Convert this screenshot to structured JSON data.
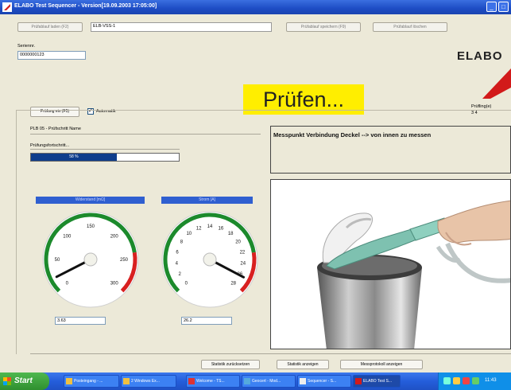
{
  "window": {
    "title": "ELABO Test Sequencer - Version[19.09.2003 17:05:00]"
  },
  "toolbar": {
    "btn1_label": "Prüfablauf laden (F2)",
    "combo_value": "ELB-VSS-1",
    "btn2_label": "Prüfablauf speichern (F9)",
    "btn3_label": "Prüfablauf löschen"
  },
  "serial": {
    "label": "Seriennr.",
    "value": "0000000123"
  },
  "logo": {
    "text": "ELABO"
  },
  "controls": {
    "start_label": "Prüfung ein (F5)",
    "auto_checkbox_label": "Automatik",
    "auto_checked": true
  },
  "status": {
    "text": "Prüfen..."
  },
  "counter": {
    "label": "Prüfling(e)",
    "value": "3 4"
  },
  "group": {
    "title": "PLB 05 - Prüfschritt Name"
  },
  "progress": {
    "label": "Prüfungsfortschritt...",
    "text": "58 %",
    "percent": 58
  },
  "gauges": [
    {
      "title": "Widerstand [mΩ]",
      "value": "3.63",
      "ticks": [
        "0",
        "50",
        "100",
        "150",
        "200",
        "250",
        "300"
      ],
      "needle": 20,
      "min": 0,
      "max": 300
    },
    {
      "title": "Strom [A]",
      "value": "26.2",
      "ticks": [
        "0",
        "2",
        "4",
        "6",
        "8",
        "10",
        "12",
        "14",
        "16",
        "18",
        "20",
        "22",
        "24",
        "26",
        "28"
      ],
      "needle": 26.2,
      "min": 0,
      "max": 28
    }
  ],
  "message": {
    "text": "Messpunkt Verbindung Deckel --> von innen zu messen"
  },
  "bottom_buttons": [
    "Statistik zurücksetzen",
    "Statistik anzeigen",
    "Messprotokoll anzeigen"
  ],
  "taskbar": {
    "start_label": "Start",
    "tasks": [
      "Posteingang - ...",
      "2 Windows Ex...",
      "Welcome - TS...",
      "Geocert - Mod...",
      "Sequencer - S...",
      "ELABO Test S..."
    ],
    "time": "11:43"
  },
  "colors": {
    "accent": "#2f5fd0",
    "status_bg": "#ffee00",
    "gauge_green": "#1c8a2c",
    "gauge_red": "#d82020"
  }
}
